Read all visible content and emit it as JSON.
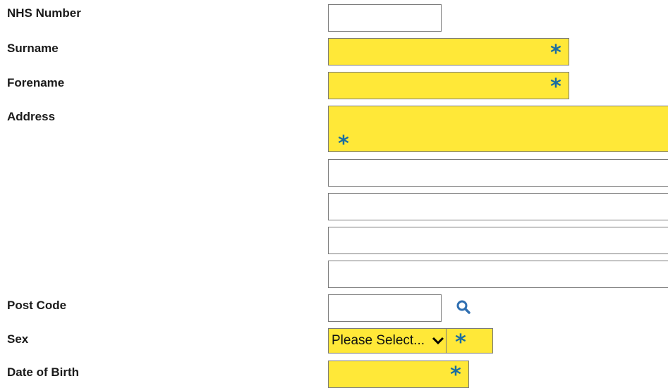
{
  "form": {
    "labels": {
      "nhs_number": "NHS Number",
      "surname": "Surname",
      "forename": "Forename",
      "address": "Address",
      "post_code": "Post Code",
      "sex": "Sex",
      "date_of_birth": "Date of Birth"
    },
    "fields": {
      "nhs_number": "",
      "surname": "",
      "forename": "",
      "address_line1": "",
      "address_line2": "",
      "address_line3": "",
      "address_line4": "",
      "address_line5": "",
      "post_code": "",
      "date_of_birth": ""
    },
    "sex_select": {
      "selected": "Please Select..."
    },
    "required_marker": "*",
    "icons": {
      "post_code_search": "search-icon",
      "sex_dropdown": "chevron-down-icon"
    },
    "colors": {
      "required_bg": "#ffe838",
      "required_marker": "#1b6ea0",
      "search_icon": "#2f6fb1"
    }
  }
}
